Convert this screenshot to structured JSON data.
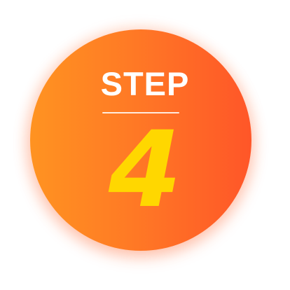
{
  "badge": {
    "label": "STEP",
    "number": "4",
    "colors": {
      "gradient_start": "#ff9321",
      "gradient_end": "#ff5628",
      "label_color": "#ffffff",
      "number_color": "#ffd700"
    }
  }
}
